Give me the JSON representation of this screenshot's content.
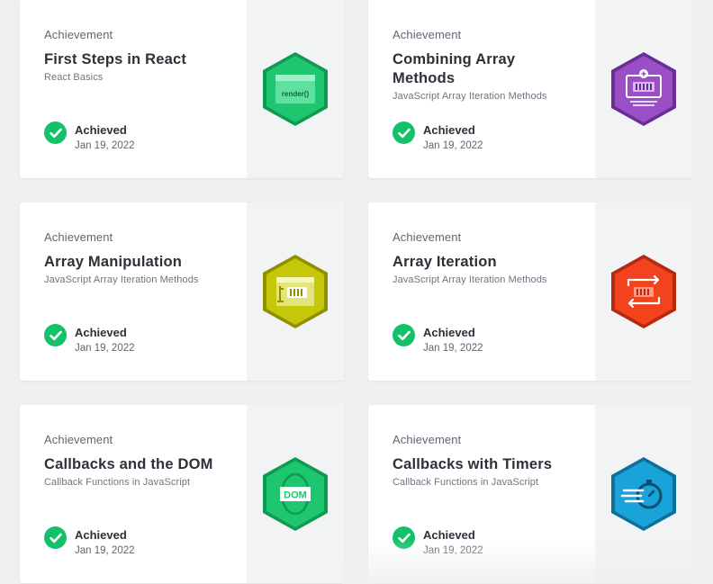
{
  "cards": [
    {
      "kind": "Achievement",
      "title": "First Steps in React",
      "course": "React Basics",
      "status": "Achieved",
      "date": "Jan 19, 2022",
      "badge_text": "render()",
      "badge_icon": "react-render-badge-icon",
      "color": "#1ec66f",
      "dark": "#0f9a52"
    },
    {
      "kind": "Achievement",
      "title": "Combining Array Methods",
      "course": "JavaScript Array Iteration Methods",
      "status": "Achieved",
      "date": "Jan 19, 2022",
      "badge_text": "",
      "badge_icon": "array-combine-badge-icon",
      "color": "#9b4fc6",
      "dark": "#6a2d96"
    },
    {
      "kind": "Achievement",
      "title": "Array Manipulation",
      "course": "JavaScript Array Iteration Methods",
      "status": "Achieved",
      "date": "Jan 19, 2022",
      "badge_text": "",
      "badge_icon": "array-manipulation-badge-icon",
      "color": "#c4c70a",
      "dark": "#8f9100"
    },
    {
      "kind": "Achievement",
      "title": "Array Iteration",
      "course": "JavaScript Array Iteration Methods",
      "status": "Achieved",
      "date": "Jan 19, 2022",
      "badge_text": "",
      "badge_icon": "array-iteration-badge-icon",
      "color": "#f2421e",
      "dark": "#b42a0e"
    },
    {
      "kind": "Achievement",
      "title": "Callbacks and the DOM",
      "course": "Callback Functions in JavaScript",
      "status": "Achieved",
      "date": "Jan 19, 2022",
      "badge_text": "DOM",
      "badge_icon": "dom-callback-badge-icon",
      "color": "#1ec66f",
      "dark": "#0f9a52"
    },
    {
      "kind": "Achievement",
      "title": "Callbacks with Timers",
      "course": "Callback Functions in JavaScript",
      "status": "Achieved",
      "date": "Jan 19, 2022",
      "badge_text": "",
      "badge_icon": "timer-badge-icon",
      "color": "#1aa3d9",
      "dark": "#0e6f99"
    }
  ]
}
